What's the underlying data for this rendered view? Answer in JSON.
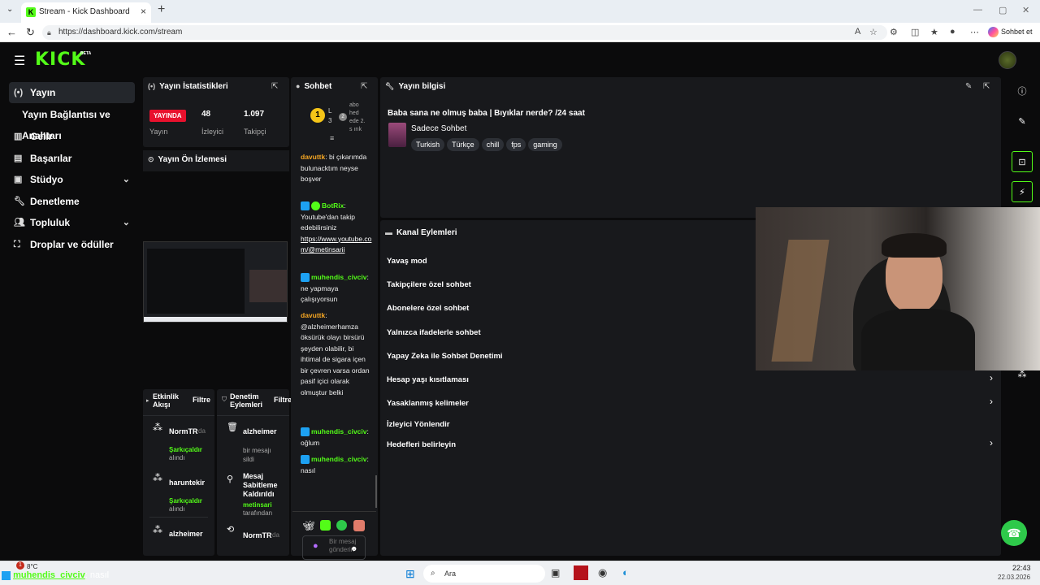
{
  "browser": {
    "tab_title": "Stream - Kick Dashboard",
    "url": "https://dashboard.kick.com/stream",
    "copilot_label": "Sohbet et"
  },
  "app": {
    "logo": "KICK",
    "logo_badge": "BETA"
  },
  "sidebar": {
    "items": [
      {
        "label": "Yayın",
        "icon": "broadcast-icon"
      },
      {
        "label": "Yayın Bağlantısı ve Anahtarı"
      },
      {
        "label": "Gelir",
        "icon": "revenue-icon"
      },
      {
        "label": "Başarılar",
        "icon": "achievements-icon"
      },
      {
        "label": "Stüdyo",
        "icon": "studio-icon"
      },
      {
        "label": "Denetleme",
        "icon": "wrench-icon"
      },
      {
        "label": "Topluluk",
        "icon": "community-icon"
      },
      {
        "label": "Droplar ve ödüller",
        "icon": "drops-icon"
      }
    ]
  },
  "stats": {
    "title": "Yayın İstatistikleri",
    "status": "YAYINDA",
    "status_label": "Yayın",
    "viewers": "48",
    "viewers_label": "İzleyici",
    "followers": "1.097",
    "followers_label": "Takipçi"
  },
  "preview": {
    "title": "Yayın Ön İzlemesi"
  },
  "activity": {
    "title": "Etkinlik Akışı",
    "filter": "Filtre",
    "items": [
      {
        "user": "NormTR",
        "suffix": "da",
        "event": "Şarkıçaldır",
        "sub": "alındı"
      },
      {
        "user": "haruntekir",
        "event": "Şarkıçaldır",
        "sub": "alındı"
      },
      {
        "user": "alzheimer"
      }
    ]
  },
  "moderation": {
    "title": "Denetim Eylemleri",
    "filter": "Filtre",
    "items": [
      {
        "user": "alzheimer",
        "detail": "bir mesajı sildi"
      },
      {
        "user": "Mesaj Sabitleme Kaldırıldı",
        "by": "metinsari",
        "sub": "tarafından"
      },
      {
        "user": "NormTR",
        "suffix": "da"
      }
    ]
  },
  "chat": {
    "title": "Sohbet",
    "pinned_rank": "1",
    "pinned_level": "L 3",
    "pinned_count": "2",
    "pinned_text": "abo hed ede 2. s ırık",
    "messages": [
      {
        "user": "davuttk",
        "color": "#f5a623",
        "text": "bi çıkarımda bulunacktım neyse boşver"
      },
      {
        "user": "BotRix",
        "color": "#53fc18",
        "text": "Youtube'dan takip edebilirsiniz",
        "link": "https://www.youtube.com/@metinsarii"
      },
      {
        "user": "muhendis_civciv",
        "color": "#53fc18",
        "text": "ne yapmaya çalışıyorsun"
      },
      {
        "user": "davuttk",
        "color": "#f5a623",
        "text": "@alzheimerhamza öksürük olayı birsürü şeyden olabilir, bi ihtimal de sigara içen bir çevren varsa ordan pasif içici olarak olmuştur belki"
      },
      {
        "user": "muhendis_civciv",
        "color": "#53fc18",
        "text": "oğlum"
      },
      {
        "user": "muhendis_civciv",
        "color": "#53fc18",
        "text": "nasıl"
      }
    ],
    "input_placeholder": "Bir mesaj gönderin",
    "footer_left": "∞",
    "footer_count": "0"
  },
  "stream_info": {
    "title": "Yayın bilgisi",
    "stream_title": "Baba sana ne olmuş baba | Bıyıklar nerde? /24 saat",
    "category": "Sadece Sohbet",
    "tags": [
      "Turkish",
      "Türkçe",
      "chill",
      "fps",
      "gaming"
    ]
  },
  "channel_actions": {
    "title": "Kanal Eylemleri",
    "items": [
      {
        "label": "Yavaş mod",
        "chevron": false
      },
      {
        "label": "Takipçilere özel sohbet",
        "chevron": false
      },
      {
        "label": "Abonelere özel sohbet",
        "chevron": false
      },
      {
        "label": "Yalnızca ifadelerle sohbet",
        "chevron": false
      },
      {
        "label": "Yapay Zeka ile Sohbet Denetimi",
        "chevron": false
      },
      {
        "label": "Hesap yaşı kısıtlaması",
        "chevron": true
      },
      {
        "label": "Yasaklanmış kelimeler",
        "chevron": true
      },
      {
        "label": "İzleyici Yönlendir",
        "chevron": false
      },
      {
        "label": "Hedefleri belirleyin",
        "chevron": true
      }
    ]
  },
  "overlay_chat": {
    "user": "muhendis_civciv",
    "text": ": nasıl"
  },
  "taskbar": {
    "weather": "8°C",
    "search_placeholder": "Ara",
    "time": "22:43",
    "date": "22.03.2026",
    "notif": "1"
  },
  "colors": {
    "brand": "#53fc18",
    "live": "#e8112d",
    "panel": "#18191c"
  }
}
